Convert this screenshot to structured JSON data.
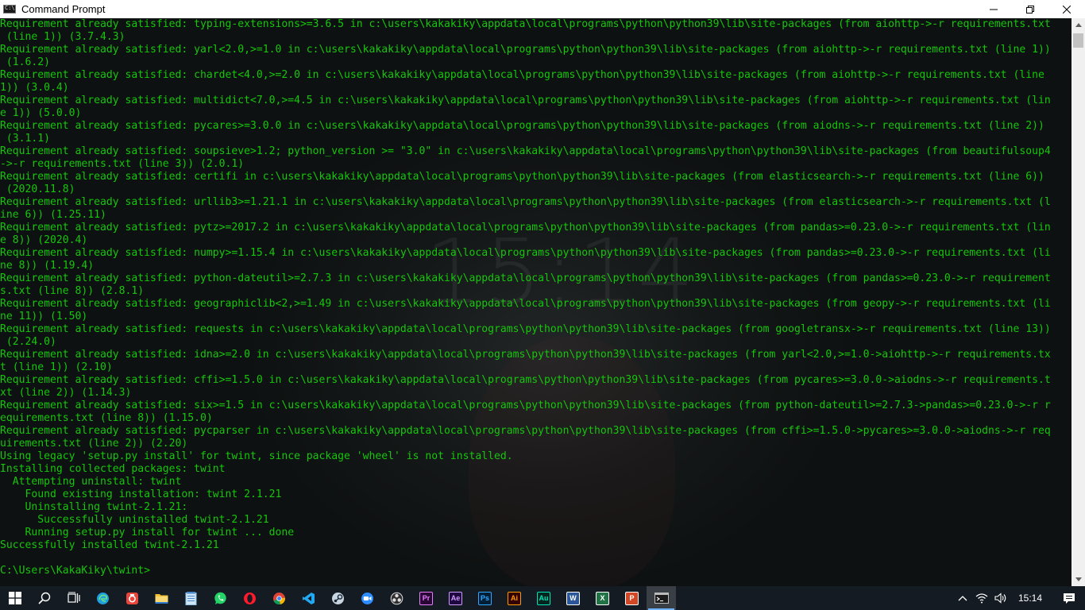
{
  "window": {
    "title": "Command Prompt",
    "minimize_icon": "minimize-icon",
    "maximize_icon": "restore-icon",
    "close_icon": "close-icon"
  },
  "console": {
    "watermark_time": "15:14",
    "text_color": "#16c60c",
    "lines": [
      "Requirement already satisfied: typing-extensions>=3.6.5 in c:\\users\\kakakiky\\appdata\\local\\programs\\python\\python39\\lib\\site-packages (from aiohttp->-r requirements.txt",
      " (line 1)) (3.7.4.3)",
      "Requirement already satisfied: yarl<2.0,>=1.0 in c:\\users\\kakakiky\\appdata\\local\\programs\\python\\python39\\lib\\site-packages (from aiohttp->-r requirements.txt (line 1))",
      " (1.6.2)",
      "Requirement already satisfied: chardet<4.0,>=2.0 in c:\\users\\kakakiky\\appdata\\local\\programs\\python\\python39\\lib\\site-packages (from aiohttp->-r requirements.txt (line",
      "1)) (3.0.4)",
      "Requirement already satisfied: multidict<7.0,>=4.5 in c:\\users\\kakakiky\\appdata\\local\\programs\\python\\python39\\lib\\site-packages (from aiohttp->-r requirements.txt (lin",
      "e 1)) (5.0.0)",
      "Requirement already satisfied: pycares>=3.0.0 in c:\\users\\kakakiky\\appdata\\local\\programs\\python\\python39\\lib\\site-packages (from aiodns->-r requirements.txt (line 2))",
      " (3.1.1)",
      "Requirement already satisfied: soupsieve>1.2; python_version >= \"3.0\" in c:\\users\\kakakiky\\appdata\\local\\programs\\python\\python39\\lib\\site-packages (from beautifulsoup4",
      "->-r requirements.txt (line 3)) (2.0.1)",
      "Requirement already satisfied: certifi in c:\\users\\kakakiky\\appdata\\local\\programs\\python\\python39\\lib\\site-packages (from elasticsearch->-r requirements.txt (line 6))",
      " (2020.11.8)",
      "Requirement already satisfied: urllib3>=1.21.1 in c:\\users\\kakakiky\\appdata\\local\\programs\\python\\python39\\lib\\site-packages (from elasticsearch->-r requirements.txt (l",
      "ine 6)) (1.25.11)",
      "Requirement already satisfied: pytz>=2017.2 in c:\\users\\kakakiky\\appdata\\local\\programs\\python\\python39\\lib\\site-packages (from pandas>=0.23.0->-r requirements.txt (lin",
      "e 8)) (2020.4)",
      "Requirement already satisfied: numpy>=1.15.4 in c:\\users\\kakakiky\\appdata\\local\\programs\\python\\python39\\lib\\site-packages (from pandas>=0.23.0->-r requirements.txt (li",
      "ne 8)) (1.19.4)",
      "Requirement already satisfied: python-dateutil>=2.7.3 in c:\\users\\kakakiky\\appdata\\local\\programs\\python\\python39\\lib\\site-packages (from pandas>=0.23.0->-r requirement",
      "s.txt (line 8)) (2.8.1)",
      "Requirement already satisfied: geographiclib<2,>=1.49 in c:\\users\\kakakiky\\appdata\\local\\programs\\python\\python39\\lib\\site-packages (from geopy->-r requirements.txt (li",
      "ne 11)) (1.50)",
      "Requirement already satisfied: requests in c:\\users\\kakakiky\\appdata\\local\\programs\\python\\python39\\lib\\site-packages (from googletransx->-r requirements.txt (line 13))",
      " (2.24.0)",
      "Requirement already satisfied: idna>=2.0 in c:\\users\\kakakiky\\appdata\\local\\programs\\python\\python39\\lib\\site-packages (from yarl<2.0,>=1.0->aiohttp->-r requirements.tx",
      "t (line 1)) (2.10)",
      "Requirement already satisfied: cffi>=1.5.0 in c:\\users\\kakakiky\\appdata\\local\\programs\\python\\python39\\lib\\site-packages (from pycares>=3.0.0->aiodns->-r requirements.t",
      "xt (line 2)) (1.14.3)",
      "Requirement already satisfied: six>=1.5 in c:\\users\\kakakiky\\appdata\\local\\programs\\python\\python39\\lib\\site-packages (from python-dateutil>=2.7.3->pandas>=0.23.0->-r r",
      "equirements.txt (line 8)) (1.15.0)",
      "Requirement already satisfied: pycparser in c:\\users\\kakakiky\\appdata\\local\\programs\\python\\python39\\lib\\site-packages (from cffi>=1.5.0->pycares>=3.0.0->aiodns->-r req",
      "uirements.txt (line 2)) (2.20)",
      "Using legacy 'setup.py install' for twint, since package 'wheel' is not installed.",
      "Installing collected packages: twint",
      "  Attempting uninstall: twint",
      "    Found existing installation: twint 2.1.21",
      "    Uninstalling twint-2.1.21:",
      "      Successfully uninstalled twint-2.1.21",
      "    Running setup.py install for twint ... done",
      "Successfully installed twint-2.1.21",
      ""
    ],
    "prompt": "C:\\Users\\KakaKiky\\twint>"
  },
  "taskbar": {
    "items": [
      {
        "name": "start-button",
        "icon": "windows-logo-icon"
      },
      {
        "name": "search-button",
        "icon": "search-icon"
      },
      {
        "name": "task-view-button",
        "icon": "task-view-icon"
      },
      {
        "name": "edge-button",
        "icon": "edge-icon",
        "color": "#1fa0e0"
      },
      {
        "name": "app-red-button",
        "icon": "camera-icon",
        "color": "#e8453c"
      },
      {
        "name": "file-explorer-button",
        "icon": "folder-icon",
        "color": "#f2c035"
      },
      {
        "name": "notepad-button",
        "icon": "notepad-icon",
        "color": "#8fc0e8"
      },
      {
        "name": "whatsapp-button",
        "icon": "whatsapp-icon",
        "color": "#25d366"
      },
      {
        "name": "opera-button",
        "icon": "opera-icon",
        "color": "#ff1b2d"
      },
      {
        "name": "chrome-button",
        "icon": "chrome-icon",
        "color": "#4caf50"
      },
      {
        "name": "vscode-button",
        "icon": "vscode-icon",
        "color": "#23a9f2"
      },
      {
        "name": "steam-button",
        "icon": "steam-icon",
        "color": "#c7d5e0"
      },
      {
        "name": "zoom-button",
        "icon": "zoom-icon",
        "color": "#2d8cff"
      },
      {
        "name": "obs-button",
        "icon": "obs-icon",
        "color": "#dddddd"
      },
      {
        "name": "premiere-button",
        "icon": "premiere-icon",
        "label": "Pr",
        "color": "#e77cff",
        "bg": "#2a0634"
      },
      {
        "name": "after-effects-button",
        "icon": "after-effects-icon",
        "label": "Ae",
        "color": "#d29bff",
        "bg": "#1f0740"
      },
      {
        "name": "photoshop-button",
        "icon": "photoshop-icon",
        "label": "Ps",
        "color": "#31a8ff",
        "bg": "#001e36"
      },
      {
        "name": "illustrator-button",
        "icon": "illustrator-icon",
        "label": "Ai",
        "color": "#ff9a00",
        "bg": "#330000"
      },
      {
        "name": "audition-button",
        "icon": "audition-icon",
        "label": "Au",
        "color": "#00e4bb",
        "bg": "#00261e"
      },
      {
        "name": "word-button",
        "icon": "word-icon",
        "label": "W",
        "color": "#ffffff",
        "bg": "#2b579a"
      },
      {
        "name": "excel-button",
        "icon": "excel-icon",
        "label": "X",
        "color": "#ffffff",
        "bg": "#217346"
      },
      {
        "name": "powerpoint-button",
        "icon": "powerpoint-icon",
        "label": "P",
        "color": "#ffffff",
        "bg": "#d24726"
      },
      {
        "name": "command-prompt-button",
        "icon": "command-prompt-icon",
        "active": true
      }
    ],
    "tray": {
      "chevron_icon": "chevron-up-icon",
      "wifi_icon": "wifi-icon",
      "volume_icon": "volume-icon",
      "time": "15:14",
      "notification_icon": "notification-icon"
    }
  }
}
